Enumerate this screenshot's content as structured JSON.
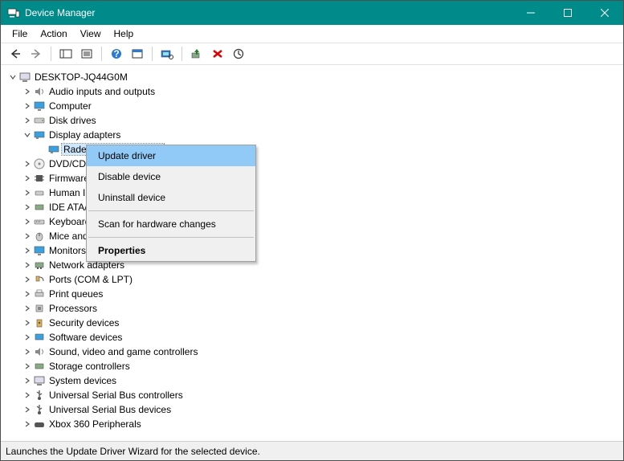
{
  "title": "Device Manager",
  "menubar": [
    "File",
    "Action",
    "View",
    "Help"
  ],
  "status": "Launches the Update Driver Wizard for the selected device.",
  "rootNode": "DESKTOP-JQ44G0M",
  "categories": {
    "audio": "Audio inputs and outputs",
    "computer": "Computer",
    "disk": "Disk drives",
    "display": "Display adapters",
    "dvd": "DVD/CD-ROM drives",
    "firmware": "Firmware",
    "hid": "Human Interface Devices",
    "ide": "IDE ATA/ATAPI controllers",
    "keyboard": "Keyboards",
    "mice": "Mice and other pointing devices",
    "monitors": "Monitors",
    "network": "Network adapters",
    "ports": "Ports (COM & LPT)",
    "printqueues": "Print queues",
    "processors": "Processors",
    "security": "Security devices",
    "software": "Software devices",
    "sound": "Sound, video and game controllers",
    "storage": "Storage controllers",
    "system": "System devices",
    "usbctrl": "Universal Serial Bus controllers",
    "usbdev": "Universal Serial Bus devices",
    "xbox": "Xbox 360 Peripherals"
  },
  "selectedDevice": "Radeon RX 580 Series",
  "contextMenu": {
    "update": "Update driver",
    "disable": "Disable device",
    "uninstall": "Uninstall device",
    "scan": "Scan for hardware changes",
    "properties": "Properties"
  }
}
